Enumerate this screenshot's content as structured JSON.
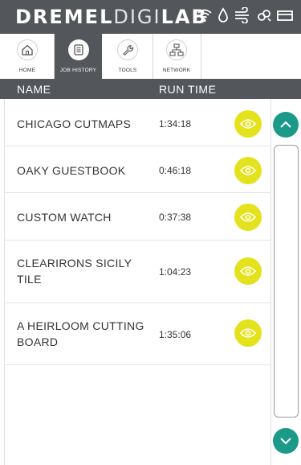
{
  "brand": {
    "part1": "DREMEL",
    "part2": "DIGI",
    "part3": "LAB"
  },
  "status_icons": [
    "wifi-icon",
    "water-drop-icon",
    "fan-air-icon",
    "filter-icon",
    "tray-icon"
  ],
  "tabs": [
    {
      "label": "HOME",
      "icon": "home-icon",
      "active": false
    },
    {
      "label": "JOB HISTORY",
      "icon": "job-history-icon",
      "active": true
    },
    {
      "label": "TOOLS",
      "icon": "wrench-icon",
      "active": false
    },
    {
      "label": "NETWORK",
      "icon": "network-icon",
      "active": false
    }
  ],
  "columns": {
    "name": "NAME",
    "run_time": "RUN TIME"
  },
  "jobs": [
    {
      "name_lines": [
        "CHICAGO CUTMAPS"
      ],
      "run_time": "1:34:18"
    },
    {
      "name_lines": [
        "OAKY GUESTBOOK"
      ],
      "run_time": "0:46:18"
    },
    {
      "name_lines": [
        "CUSTOM WATCH"
      ],
      "run_time": "0:37:38"
    },
    {
      "name_lines": [
        "CLEARIRONS SICILY",
        "TILE"
      ],
      "run_time": "1:04:23"
    },
    {
      "name_lines": [
        "A HEIRLOOM CUTTING",
        "BOARD"
      ],
      "run_time": "1:35:06"
    }
  ],
  "colors": {
    "bar": "#53565a",
    "accent_yellow": "#e4e21d",
    "accent_teal": "#1b9a8a"
  }
}
